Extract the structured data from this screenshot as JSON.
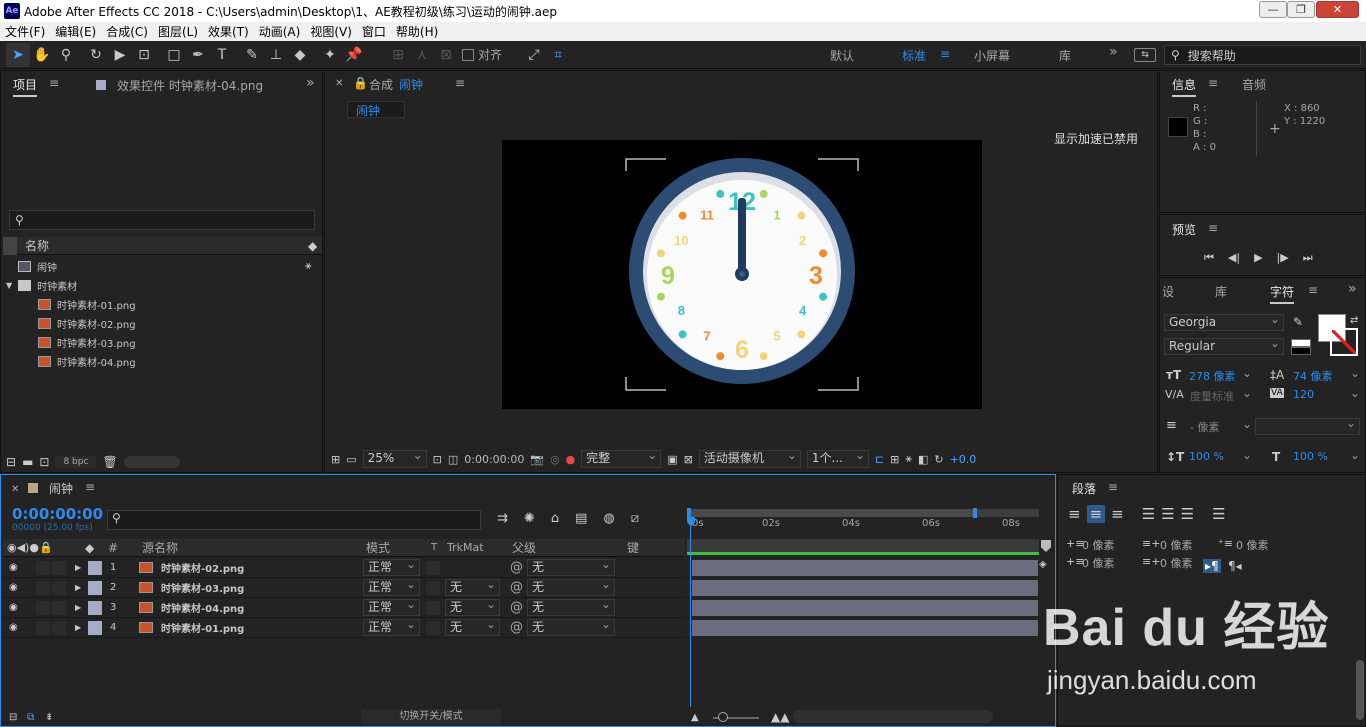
{
  "window": {
    "title": "Adobe After Effects CC 2018 - C:\\Users\\admin\\Desktop\\1、AE教程初级\\练习\\运动的闹钟.aep",
    "logo": "Ae",
    "min": "—",
    "max": "❐",
    "close": "✕"
  },
  "menu": [
    "文件(F)",
    "编辑(E)",
    "合成(C)",
    "图层(L)",
    "效果(T)",
    "动画(A)",
    "视图(V)",
    "窗口",
    "帮助(H)"
  ],
  "toolbar": {
    "snap_label": "对齐",
    "workspaces": [
      "默认",
      "标准",
      "小屏幕",
      "库"
    ],
    "more": "»",
    "search_placeholder": "搜索帮助"
  },
  "project": {
    "tab_project": "项目",
    "tab_effects": "效果控件 时钟素材-04.png",
    "col_name": "名称",
    "items": [
      {
        "name": "闹钟",
        "type": "comp",
        "indent": 0
      },
      {
        "name": "时钟素材",
        "type": "folder",
        "indent": 0
      },
      {
        "name": "时钟素材-01.png",
        "type": "image",
        "indent": 1
      },
      {
        "name": "时钟素材-02.png",
        "type": "image",
        "indent": 1
      },
      {
        "name": "时钟素材-03.png",
        "type": "image",
        "indent": 1
      },
      {
        "name": "时钟素材-04.png",
        "type": "image",
        "indent": 1
      }
    ],
    "bpc": "8 bpc"
  },
  "composition": {
    "tab_label": "合成",
    "comp_name": "闹钟",
    "breadcrumb": "闹钟",
    "gpu_notice": "显示加速已禁用",
    "zoom": "25%",
    "timecode": "0:00:00:00",
    "quality": "完整",
    "camera": "活动摄像机",
    "views": "1个...",
    "exposure": "+0.0",
    "clock_numbers": [
      {
        "n": "12",
        "color": "#3cc4c4"
      },
      {
        "n": "1",
        "color": "#a9d65c"
      },
      {
        "n": "2",
        "color": "#f1d57a"
      },
      {
        "n": "3",
        "color": "#f08a2c"
      },
      {
        "n": "4",
        "color": "#3cc4c4"
      },
      {
        "n": "5",
        "color": "#f1d57a"
      },
      {
        "n": "6",
        "color": "#f1d57a"
      },
      {
        "n": "7",
        "color": "#f08a2c"
      },
      {
        "n": "8",
        "color": "#3cc4c4"
      },
      {
        "n": "9",
        "color": "#a9d65c"
      },
      {
        "n": "10",
        "color": "#f1d57a"
      },
      {
        "n": "11",
        "color": "#f08a2c"
      }
    ]
  },
  "info": {
    "tab_info": "信息",
    "tab_audio": "音频",
    "r": "R :",
    "g": "G :",
    "b": "B :",
    "a": "A : 0",
    "x": "X : 860",
    "y": "Y : 1220"
  },
  "preview": {
    "title": "预览"
  },
  "character": {
    "tab_set": "设",
    "tab_lib": "库",
    "tab_char": "字符",
    "font": "Georgia",
    "style": "Regular",
    "size": "278 像素",
    "leading": "74 像素",
    "kerning": "度量标准",
    "tracking": "120",
    "stroke": "- 像素",
    "vscale": "100 %",
    "hscale": "100 %"
  },
  "paragraph": {
    "title": "段落",
    "indent_left": "0 像素",
    "indent_right": "0 像素",
    "indent_first": "0 像素",
    "space_before": "0 像素",
    "space_after": "0 像素"
  },
  "timeline": {
    "tab_label": "闹钟",
    "timecode": "0:00:00:00",
    "frames": "00000 (25.00 fps)",
    "col_num": "#",
    "col_source": "源名称",
    "col_mode": "模式",
    "col_t": "T",
    "col_trkmat": "TrkMat",
    "col_parent": "父级",
    "col_keys": "键",
    "ruler": [
      "0s",
      "02s",
      "04s",
      "06s",
      "08s"
    ],
    "layers": [
      {
        "num": "1",
        "name": "时钟素材-02.png",
        "mode": "正常",
        "trkmat": "",
        "parent": "无"
      },
      {
        "num": "2",
        "name": "时钟素材-03.png",
        "mode": "正常",
        "trkmat": "无",
        "parent": "无"
      },
      {
        "num": "3",
        "name": "时钟素材-04.png",
        "mode": "正常",
        "trkmat": "无",
        "parent": "无"
      },
      {
        "num": "4",
        "name": "时钟素材-01.png",
        "mode": "正常",
        "trkmat": "无",
        "parent": "无"
      }
    ],
    "toggle_label": "切换开关/模式"
  },
  "watermark": {
    "brand": "Bai du 经验",
    "url": "jingyan.baidu.com"
  }
}
